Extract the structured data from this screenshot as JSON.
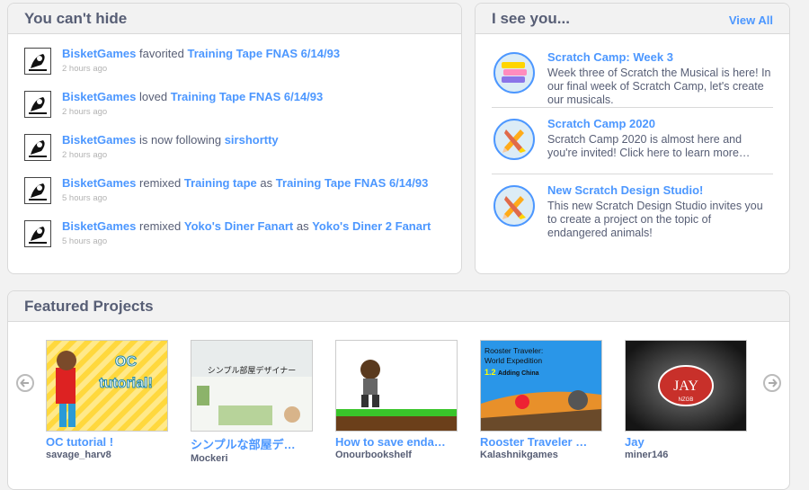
{
  "activity": {
    "title": "You can't hide",
    "items": [
      {
        "user": "BisketGames",
        "action": "favorited",
        "target": "Training Tape FNAS 6/14/93",
        "time": "2 hours ago"
      },
      {
        "user": "BisketGames",
        "action": "loved",
        "target": "Training Tape FNAS 6/14/93",
        "time": "2 hours ago"
      },
      {
        "user": "BisketGames",
        "action": "is now following",
        "target": "sirshortty",
        "time": "2 hours ago"
      },
      {
        "user": "BisketGames",
        "action": "remixed",
        "target": "Training tape",
        "joiner": "as",
        "target2": "Training Tape FNAS 6/14/93",
        "time": "5 hours ago"
      },
      {
        "user": "BisketGames",
        "action": "remixed",
        "target": "Yoko's Diner Fanart",
        "joiner": "as",
        "target2": "Yoko's Diner 2 Fanart",
        "time": "5 hours ago"
      }
    ]
  },
  "news": {
    "title": "I see you...",
    "view_all": "View All",
    "items": [
      {
        "title": "Scratch Camp: Week 3",
        "body": "Week three of Scratch the Musical is here! In our final week of Scratch Camp, let's create our musicals.",
        "icon": "stacked-blocks-icon"
      },
      {
        "title": "Scratch Camp 2020",
        "body": "Scratch Camp 2020 is almost here and you're invited! Click here to learn more…",
        "icon": "pencil-brush-icon"
      },
      {
        "title": "New Scratch Design Studio!",
        "body": "This new Scratch Design Studio invites you to create a project on the topic of endangered animals!",
        "icon": "pencil-brush-icon"
      }
    ]
  },
  "featured": {
    "title": "Featured Projects",
    "projects": [
      {
        "title": "OC tutorial !",
        "author": "savage_harv8",
        "thumb_text": "OC tutorial!"
      },
      {
        "title": "シンプルな部屋デ…",
        "author": "Mockeri",
        "thumb_text": "シンプル部屋デザイナー"
      },
      {
        "title": "How to save enda…",
        "author": "Onourbookshelf",
        "thumb_text": ""
      },
      {
        "title": "Rooster Traveler …",
        "author": "Kalashnikgames",
        "thumb_text": "Rooster Traveler: World Expedition",
        "thumb_sub": "1.2 Adding China"
      },
      {
        "title": "Jay",
        "author": "miner146",
        "thumb_text": "JAY",
        "thumb_sub": "NZGB"
      }
    ]
  }
}
